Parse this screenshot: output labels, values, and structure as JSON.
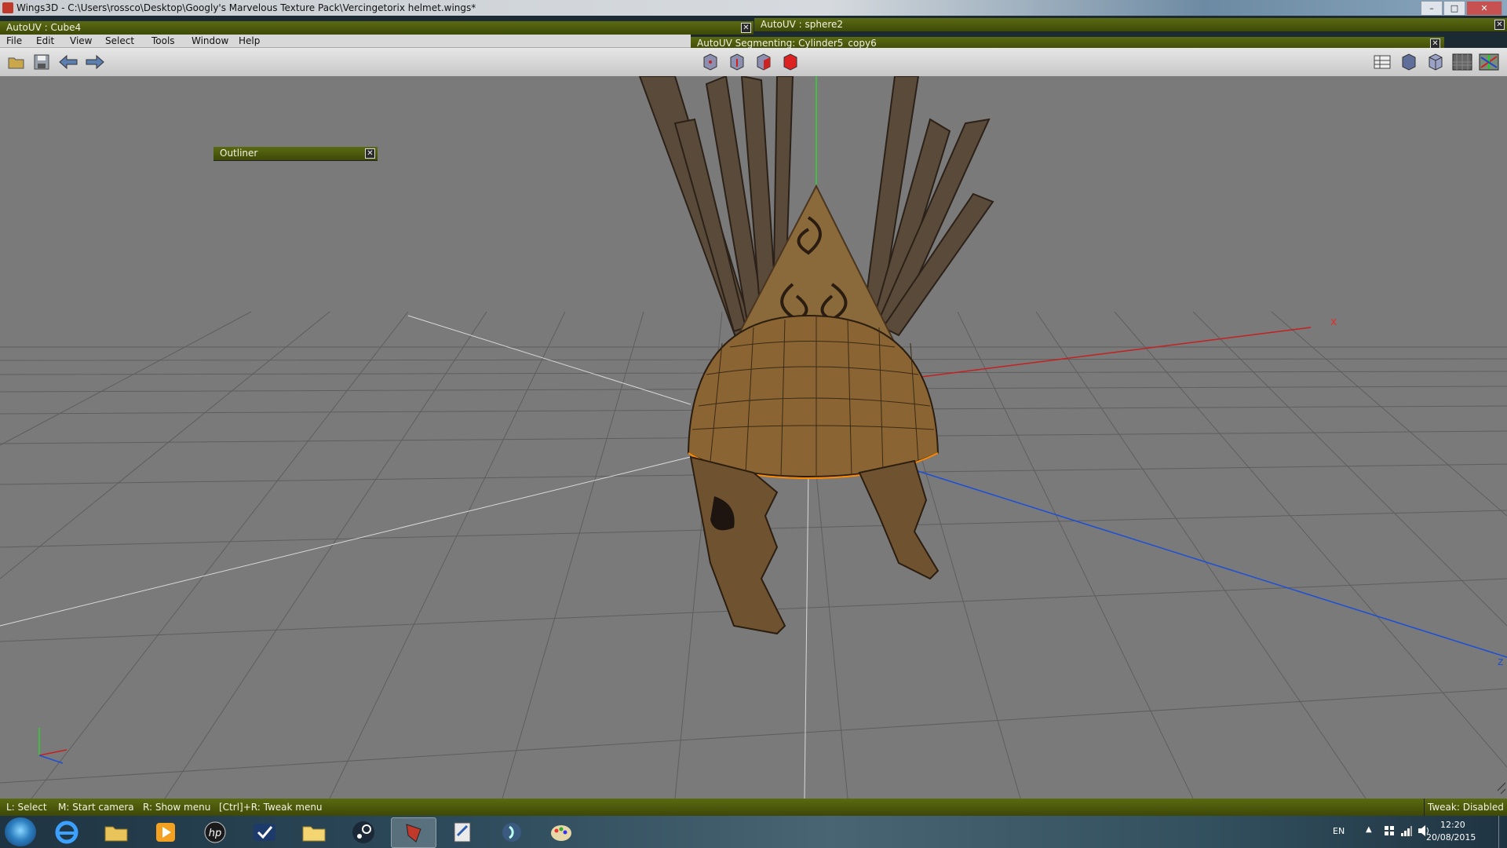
{
  "window": {
    "title": "Wings3D - C:\\Users\\rossco\\Desktop\\Googly's Marvelous Texture Pack\\Vercingetorix helmet.wings*",
    "controls": [
      "–",
      "□",
      "✕"
    ]
  },
  "panels": {
    "autouv_cube": "AutoUV : Cube4",
    "autouv_sphere": "AutoUV : sphere2",
    "autouv_segmenting": "AutoUV Segmenting: Cylinder5_copy6",
    "outliner": "Outliner"
  },
  "menu": {
    "items": [
      "File",
      "Edit",
      "View",
      "Select",
      "Tools",
      "Window",
      "Help"
    ]
  },
  "viewport": {
    "axis_x_label": "x",
    "axis_z_label": "z",
    "colors": {
      "background": "#7a7a7a",
      "grid": "#5e5e5e",
      "x_axis": "#c42020",
      "y_axis": "#2fd12f",
      "z_axis": "#1d4fd6"
    }
  },
  "status": {
    "hint_select": "L: Select",
    "hint_camera": "M: Start camera",
    "hint_menu": "R: Show menu",
    "hint_tweak": "[Ctrl]+R: Tweak menu",
    "tweak_state": "Tweak: Disabled"
  },
  "taskbar": {
    "apps": [
      "internet-explorer",
      "file-explorer",
      "media-player",
      "hp",
      "task-app",
      "folder",
      "steam",
      "wings3d",
      "document-editor",
      "audio-app",
      "paint"
    ],
    "language": "EN",
    "time": "12:20",
    "date": "20/08/2015"
  }
}
